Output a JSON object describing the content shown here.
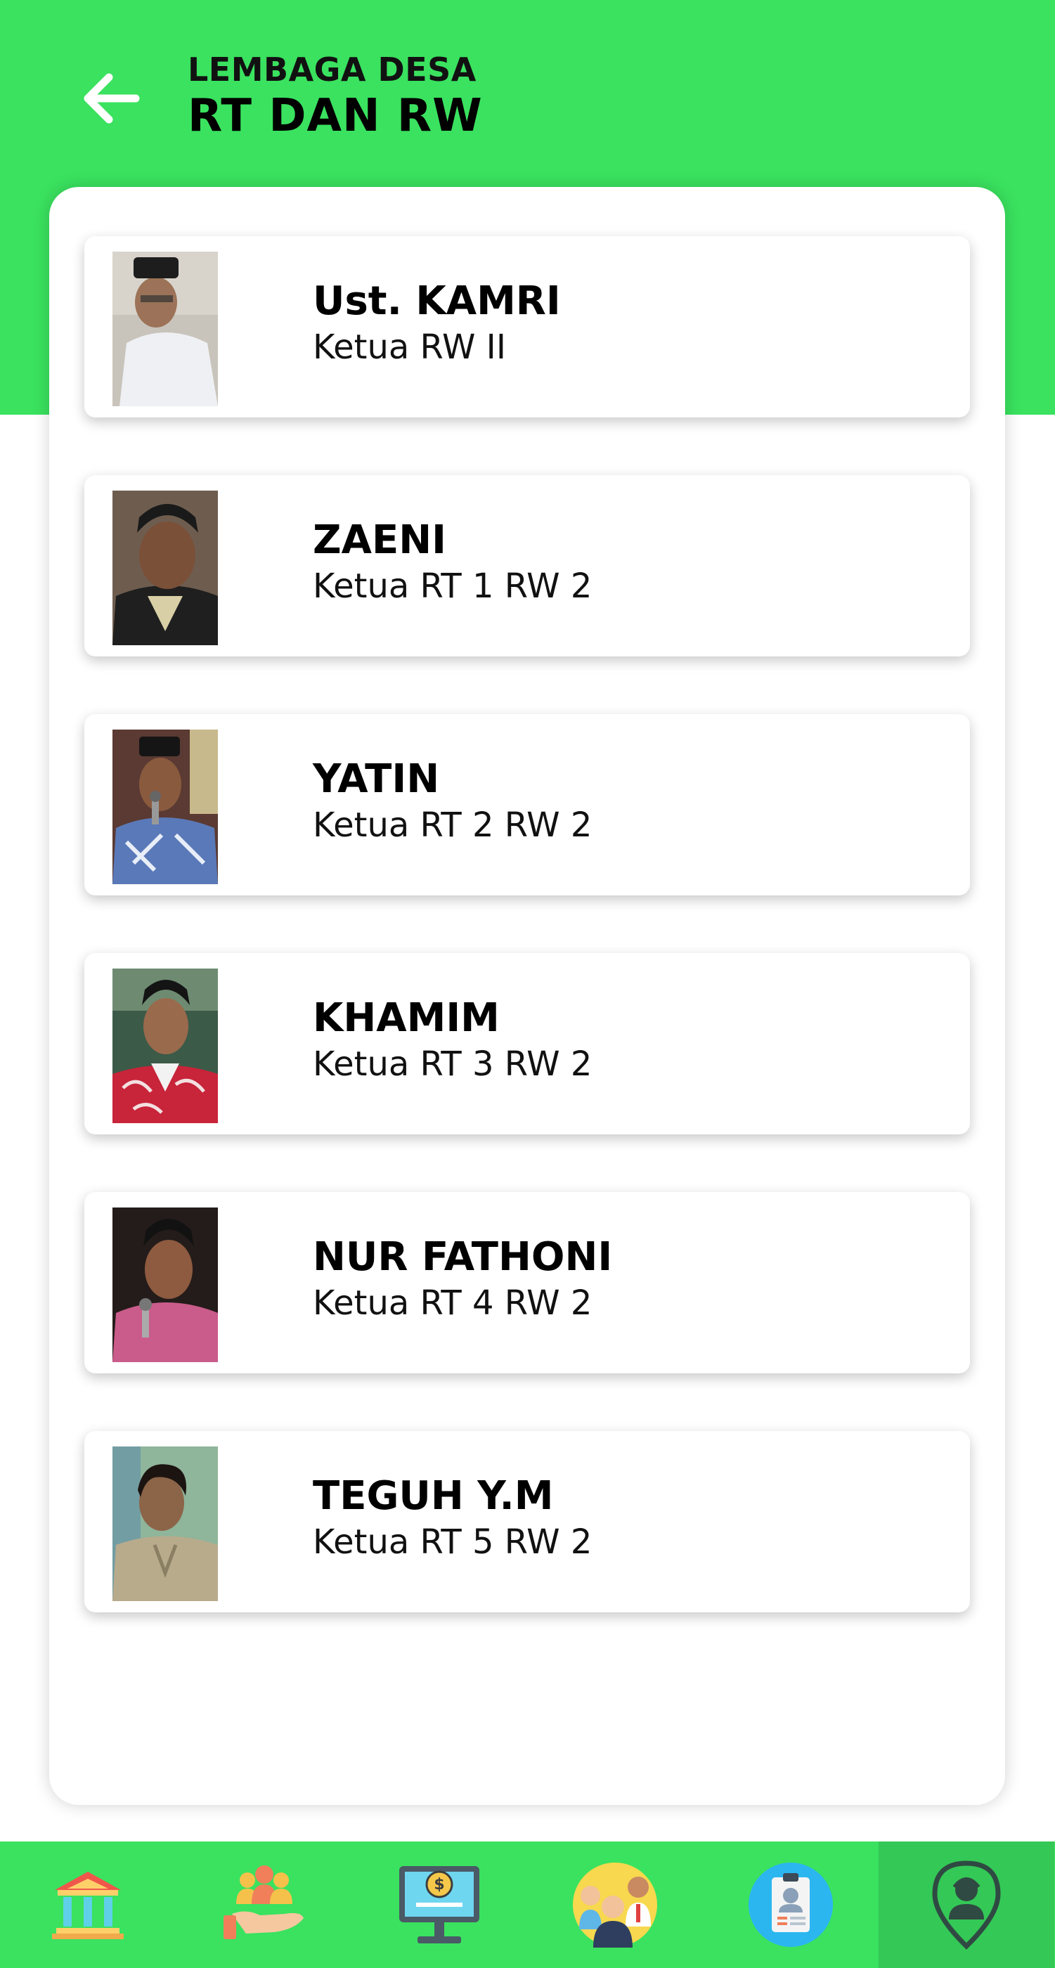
{
  "header": {
    "subtitle": "LEMBAGA DESA",
    "title": "RT DAN RW",
    "back_icon": "arrow-left-icon"
  },
  "colors": {
    "primary": "#3ae25f",
    "active_nav": "#34c856"
  },
  "members": [
    {
      "name": "Ust. KAMRI",
      "role": "Ketua RW II"
    },
    {
      "name": "ZAENI",
      "role": "Ketua RT 1 RW 2"
    },
    {
      "name": "YATIN",
      "role": "Ketua RT 2 RW 2"
    },
    {
      "name": "KHAMIM",
      "role": "Ketua RT 3 RW 2"
    },
    {
      "name": "NUR FATHONI",
      "role": "Ketua RT 4 RW 2"
    },
    {
      "name": "TEGUH Y.M",
      "role": "Ketua RT 5 RW 2"
    }
  ],
  "bottom_nav": [
    {
      "icon": "government-building-icon"
    },
    {
      "icon": "community-hand-icon"
    },
    {
      "icon": "finance-monitor-icon"
    },
    {
      "icon": "people-group-icon"
    },
    {
      "icon": "profile-clipboard-icon"
    },
    {
      "icon": "location-person-icon",
      "active": true
    }
  ]
}
